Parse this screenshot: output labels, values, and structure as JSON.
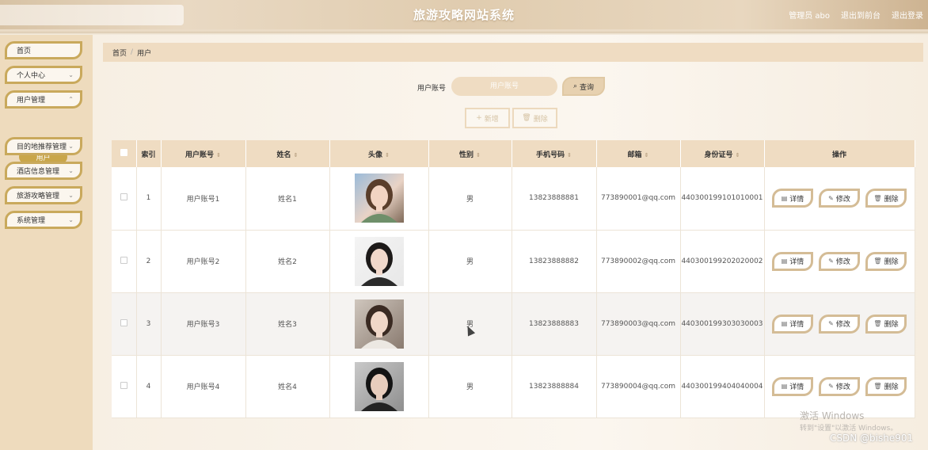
{
  "header": {
    "title": "旅游攻略网站系统",
    "links": [
      "管理员 abo",
      "退出到前台",
      "退出登录"
    ]
  },
  "sidebar": {
    "items": [
      {
        "label": "首页",
        "has_chevron": false
      },
      {
        "label": "个人中心",
        "has_chevron": true
      },
      {
        "label": "用户管理",
        "has_chevron": true
      },
      {
        "label": "目的地推荐管理",
        "has_chevron": true
      },
      {
        "label": "酒店信息管理",
        "has_chevron": true
      },
      {
        "label": "旅游攻略管理",
        "has_chevron": true
      },
      {
        "label": "系统管理",
        "has_chevron": true
      }
    ],
    "active_sub": "用户"
  },
  "breadcrumb": {
    "home": "首页",
    "sep": "/",
    "current": "用户"
  },
  "search": {
    "label": "用户账号",
    "placeholder": "用户账号",
    "button": "查询"
  },
  "actions": {
    "add": "新增",
    "delete": "删除"
  },
  "table": {
    "headers": [
      "索引",
      "用户账号",
      "姓名",
      "头像",
      "性别",
      "手机号码",
      "邮箱",
      "身份证号",
      "操作"
    ],
    "rows": [
      {
        "index": "1",
        "account": "用户账号1",
        "name": "姓名1",
        "gender": "男",
        "phone": "13823888881",
        "email": "773890001@qq.com",
        "id_no": "440300199101010001"
      },
      {
        "index": "2",
        "account": "用户账号2",
        "name": "姓名2",
        "gender": "男",
        "phone": "13823888882",
        "email": "773890002@qq.com",
        "id_no": "440300199202020002"
      },
      {
        "index": "3",
        "account": "用户账号3",
        "name": "姓名3",
        "gender": "男",
        "phone": "13823888883",
        "email": "773890003@qq.com",
        "id_no": "440300199303030003"
      },
      {
        "index": "4",
        "account": "用户账号4",
        "name": "姓名4",
        "gender": "男",
        "phone": "13823888884",
        "email": "773890004@qq.com",
        "id_no": "440300199404040004"
      }
    ],
    "ops": {
      "detail": "详情",
      "edit": "修改",
      "delete": "删除"
    }
  },
  "watermark": {
    "line1": "激活 Windows",
    "line2": "转到\"设置\"以激活 Windows。",
    "csdn": "CSDN @bishe901"
  },
  "colors": {
    "accent_gold": "#c9a95c",
    "header_beige": "#e0ccaf",
    "table_header": "#efdcc2"
  }
}
